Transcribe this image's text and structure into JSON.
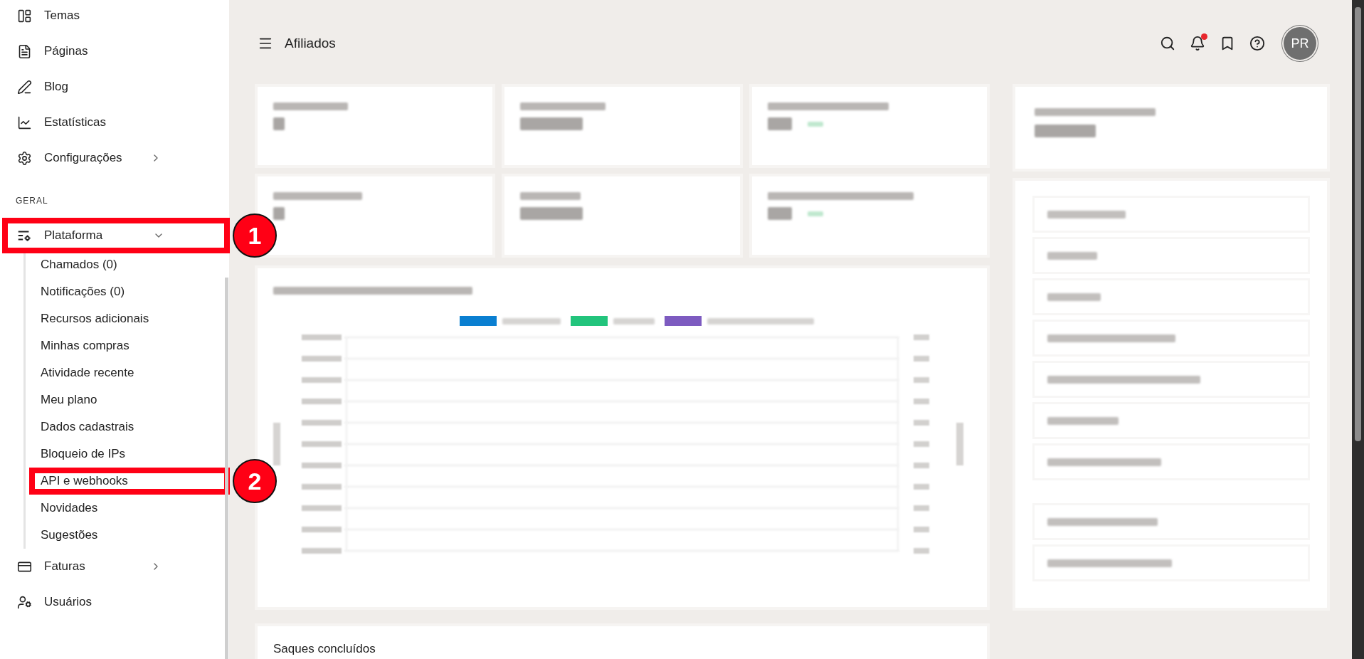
{
  "sidebar": {
    "items": [
      {
        "label": "Temas"
      },
      {
        "label": "Páginas"
      },
      {
        "label": "Blog"
      },
      {
        "label": "Estatísticas"
      },
      {
        "label": "Configurações",
        "expanded": false
      }
    ],
    "section": {
      "title": "GERAL",
      "items": [
        {
          "label": "Plataforma",
          "expanded": true,
          "marker": "1",
          "children": [
            {
              "label": "Chamados (0)"
            },
            {
              "label": "Notificações (0)"
            },
            {
              "label": "Recursos adicionais"
            },
            {
              "label": "Minhas compras"
            },
            {
              "label": "Atividade recente"
            },
            {
              "label": "Meu plano"
            },
            {
              "label": "Dados cadastrais"
            },
            {
              "label": "Bloqueio de IPs"
            },
            {
              "label": "API e webhooks",
              "marker": "2"
            },
            {
              "label": "Novidades"
            },
            {
              "label": "Sugestões"
            }
          ]
        },
        {
          "label": "Faturas",
          "expanded": false
        },
        {
          "label": "Usuários"
        }
      ]
    }
  },
  "header": {
    "title": "Afiliados",
    "notification_dot": true,
    "avatar": "PR"
  },
  "stat_cards": [
    {
      "kind": "redacted"
    },
    {
      "kind": "redacted"
    },
    {
      "kind": "redacted",
      "badge": true
    },
    {
      "kind": "redacted"
    },
    {
      "kind": "redacted"
    },
    {
      "kind": "redacted",
      "badge": true
    }
  ],
  "chart_card": {
    "legend": [
      {
        "kind": "redacted",
        "color": "#0a7fd1"
      },
      {
        "kind": "redacted",
        "color": "#22c47c"
      },
      {
        "kind": "redacted",
        "color": "#7d5bc0"
      }
    ]
  },
  "summary_card": {
    "kind": "redacted"
  },
  "side_menu": {
    "groups": [
      {
        "items": [
          {
            "kind": "redacted"
          },
          {
            "kind": "redacted"
          },
          {
            "kind": "redacted"
          },
          {
            "kind": "redacted"
          },
          {
            "kind": "redacted"
          },
          {
            "kind": "redacted"
          },
          {
            "kind": "redacted"
          }
        ]
      },
      {
        "items": [
          {
            "kind": "redacted"
          },
          {
            "kind": "redacted"
          }
        ]
      }
    ]
  },
  "bottom_card": {
    "title": "Saques concluídos"
  }
}
